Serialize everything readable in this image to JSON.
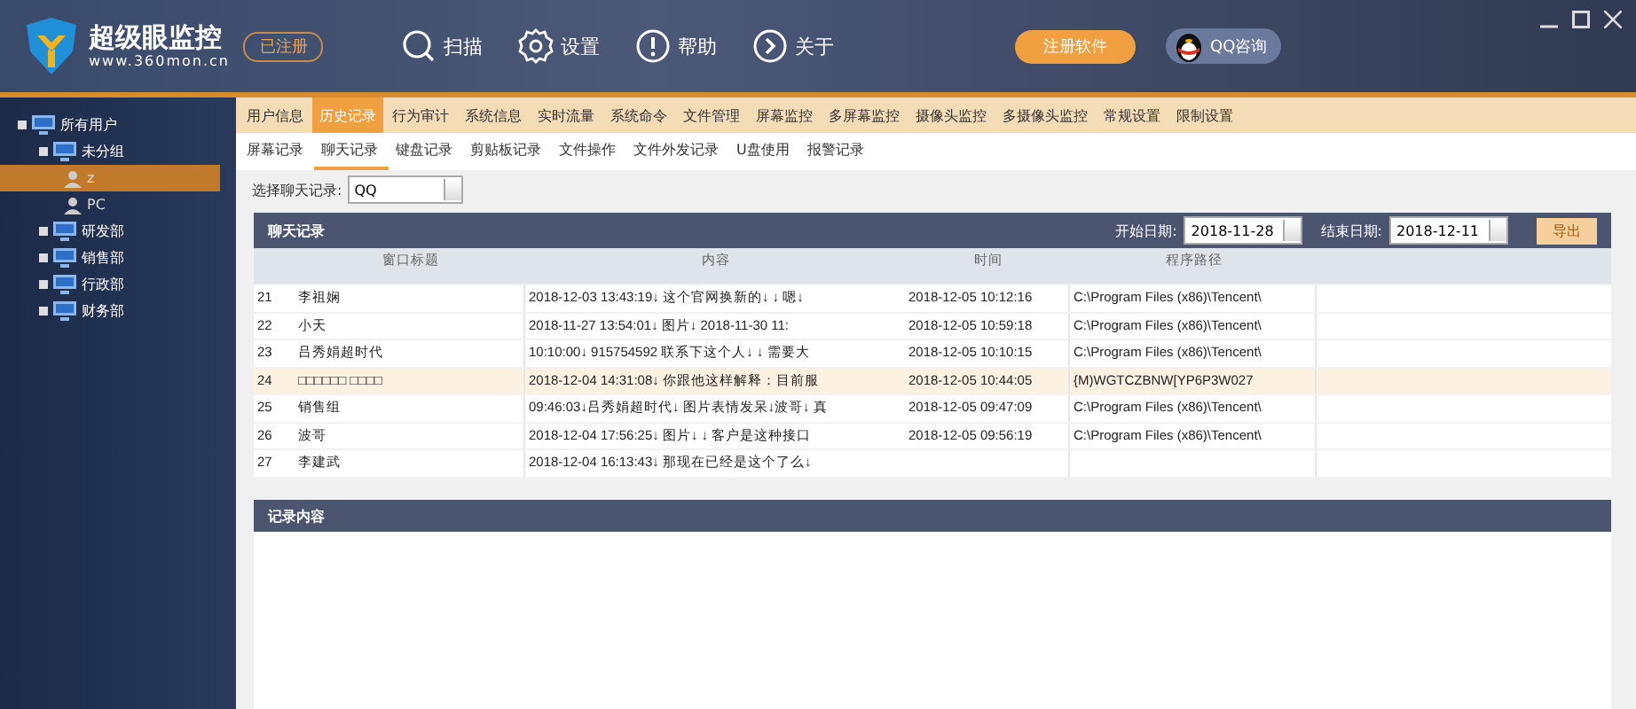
{
  "app": {
    "name": "超级眼监控",
    "url": "www.360mon.cn",
    "badge": "已注册"
  },
  "toolbar": [
    {
      "label": "扫描"
    },
    {
      "label": "设置"
    },
    {
      "label": "帮助"
    },
    {
      "label": "关于"
    }
  ],
  "register_button": "注册软件",
  "qq_button": "QQ咨询",
  "tree": [
    {
      "label": "所有用户",
      "kind": "group",
      "children": [
        {
          "label": "未分组",
          "kind": "group",
          "children": [
            {
              "label": "z",
              "kind": "user",
              "selected": true
            },
            {
              "label": "PC",
              "kind": "user",
              "selected": false
            }
          ]
        },
        {
          "label": "研发部",
          "kind": "group"
        },
        {
          "label": "销售部",
          "kind": "group"
        },
        {
          "label": "行政部",
          "kind": "group"
        },
        {
          "label": "财务部",
          "kind": "group"
        }
      ]
    }
  ],
  "tabs": [
    {
      "label": "用户信息",
      "selected": false
    },
    {
      "label": "历史记录",
      "selected": true
    },
    {
      "label": "行为审计",
      "selected": false
    },
    {
      "label": "系统信息",
      "selected": false
    },
    {
      "label": "实时流量",
      "selected": false
    },
    {
      "label": "系统命令",
      "selected": false
    },
    {
      "label": "文件管理",
      "selected": false
    },
    {
      "label": "屏幕监控",
      "selected": false
    },
    {
      "label": "多屏幕监控",
      "selected": false
    },
    {
      "label": "摄像头监控",
      "selected": false
    },
    {
      "label": "多摄像头监控",
      "selected": false
    },
    {
      "label": "常规设置",
      "selected": false
    },
    {
      "label": "限制设置",
      "selected": false
    }
  ],
  "subtabs": [
    {
      "label": "屏幕记录",
      "selected": false
    },
    {
      "label": "聊天记录",
      "selected": true
    },
    {
      "label": "键盘记录",
      "selected": false
    },
    {
      "label": "剪贴板记录",
      "selected": false
    },
    {
      "label": "文件操作",
      "selected": false
    },
    {
      "label": "文件外发记录",
      "selected": false
    },
    {
      "label": "U盘使用",
      "selected": false
    },
    {
      "label": "报警记录",
      "selected": false
    }
  ],
  "chat_select": {
    "label": "选择聊天记录:",
    "value": "QQ"
  },
  "panel": {
    "title": "聊天记录",
    "start_label": "开始日期:",
    "start_date": "2018-11-28",
    "end_label": "结束日期:",
    "end_date": "2018-12-11",
    "export_button": "导出"
  },
  "table": {
    "columns": [
      "窗口标题",
      "内容",
      "时间",
      "程序路径"
    ],
    "rows": [
      {
        "num": "21",
        "title": "李祖娴",
        "content": "2018-12-03 13:43:19↓ 这个官网换新的↓ ↓ 嗯↓",
        "time": "2018-12-05 10:12:16",
        "path": "C:\\Program Files (x86)\\Tencent\\",
        "selected": false
      },
      {
        "num": "22",
        "title": "小天",
        "content": "2018-11-27 13:54:01↓ 图片↓ 2018-11-30 11:",
        "time": "2018-12-05 10:59:18",
        "path": "C:\\Program Files (x86)\\Tencent\\",
        "selected": false
      },
      {
        "num": "23",
        "title": "吕秀娟超时代",
        "content": "10:10:00↓ 915754592 联系下这个人↓ ↓ 需要大",
        "time": "2018-12-05 10:10:15",
        "path": "C:\\Program Files (x86)\\Tencent\\",
        "selected": false
      },
      {
        "num": "24",
        "title": "□□□□□□ □□□□",
        "content": "2018-12-04 14:31:08↓ 你跟他这样解释：目前服",
        "time": "2018-12-05 10:44:05",
        "path": "{M)WGTCZBNW[YP6P3W027",
        "selected": true
      },
      {
        "num": "25",
        "title": "销售组",
        "content": "09:46:03↓吕秀娟超时代↓ 图片表情发呆↓波哥↓ 真",
        "time": "2018-12-05 09:47:09",
        "path": "C:\\Program Files (x86)\\Tencent\\",
        "selected": false
      },
      {
        "num": "26",
        "title": "波哥",
        "content": "2018-12-04 17:56:25↓ 图片↓ ↓ 客户是这种接口",
        "time": "2018-12-05 09:56:19",
        "path": "C:\\Program Files (x86)\\Tencent\\",
        "selected": false
      },
      {
        "num": "27",
        "title": "李建武",
        "content": "2018-12-04 16:13:43↓ 那现在已经是这个了么↓",
        "selected": false
      }
    ]
  },
  "detail": {
    "title": "记录内容"
  }
}
